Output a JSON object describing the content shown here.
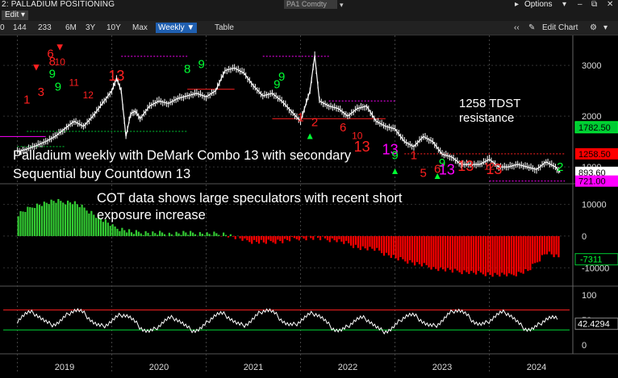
{
  "window": {
    "title": "2: PALLADIUM POSITIONING",
    "ticker": "PA1 Comdty",
    "options_label": "Options",
    "edit_label": "Edit"
  },
  "toolbar": {
    "items": [
      "144",
      "233",
      "6M",
      "3Y",
      "10Y",
      "Max"
    ],
    "selected_period": "Weekly",
    "table_label": "Table",
    "edit_chart_label": "Edit Chart"
  },
  "colors": {
    "price": "#ffffff",
    "buy_count": "#00ff33",
    "sell_count": "#ff2020",
    "countdown": "#ff00ff",
    "cot_positive": "#33cc33",
    "cot_negative": "#ff0000",
    "resistance": "#ff2020",
    "last_price_label": "#ffffff"
  },
  "annotations": {
    "resistance_title": "1258 TDST",
    "resistance_sub": "resistance",
    "price_note_line1": "Palladium weekly with DeMark Combo 13 with secondary",
    "price_note_line2": "Sequential buy Countdown 13",
    "cot_note_line1": "COT data shows large speculators with recent short",
    "cot_note_line2": "exposure increase"
  },
  "chart_data": [
    {
      "type": "line",
      "name": "price_panel",
      "x_ticks": [
        "2019",
        "2020",
        "2021",
        "2022",
        "2023",
        "2024"
      ],
      "y_ticks": [
        "3000",
        "2000",
        "1000"
      ],
      "ylim": [
        700,
        3400
      ],
      "series": [
        {
          "name": "Palladium weekly close",
          "x": [
            2019.0,
            2019.1,
            2019.2,
            2019.3,
            2019.4,
            2019.5,
            2019.6,
            2019.7,
            2019.8,
            2019.9,
            2020.0,
            2020.05,
            2020.1,
            2020.15,
            2020.2,
            2020.25,
            2020.3,
            2020.4,
            2020.5,
            2020.6,
            2020.7,
            2020.8,
            2020.9,
            2021.0,
            2021.1,
            2021.2,
            2021.3,
            2021.4,
            2021.5,
            2021.6,
            2021.7,
            2021.8,
            2021.9,
            2022.0,
            2022.1,
            2022.15,
            2022.2,
            2022.3,
            2022.4,
            2022.5,
            2022.6,
            2022.7,
            2022.8,
            2022.9,
            2023.0,
            2023.1,
            2023.2,
            2023.3,
            2023.4,
            2023.5,
            2023.6,
            2023.7,
            2023.8,
            2023.9,
            2024.0,
            2024.1,
            2024.2,
            2024.3,
            2024.4,
            2024.5,
            2024.6,
            2024.7,
            2024.75
          ],
          "values": [
            1300,
            1350,
            1420,
            1500,
            1600,
            1750,
            1900,
            1800,
            2000,
            2250,
            2500,
            2750,
            2500,
            1600,
            2050,
            2100,
            1950,
            2200,
            2300,
            2250,
            2350,
            2400,
            2450,
            2380,
            2500,
            2900,
            2950,
            2850,
            2600,
            2400,
            2450,
            2300,
            2100,
            1900,
            2500,
            3200,
            2300,
            2200,
            2150,
            2000,
            2150,
            2200,
            1900,
            1800,
            1750,
            1500,
            1400,
            1600,
            1500,
            1250,
            1200,
            1050,
            1050,
            1050,
            1150,
            1000,
            1000,
            1050,
            1000,
            950,
            1100,
            1000,
            893.6
          ]
        }
      ],
      "horizontal_levels": [
        {
          "label": "1782.50",
          "value": 1782.5,
          "color": "#00cc33"
        },
        {
          "label": "1258.50",
          "value": 1258.5,
          "color": "#ff0000"
        },
        {
          "label": "893.60",
          "value": 893.6,
          "color": "#ffffff"
        },
        {
          "label": "721.00",
          "value": 721.0,
          "color": "#ff00ff"
        }
      ],
      "markers": [
        {
          "text": "6",
          "color": "#ff2020"
        },
        {
          "text": "8",
          "color": "#ff2020"
        },
        {
          "text": "9",
          "color": "#00ff33"
        },
        {
          "text": "9",
          "color": "#00ff33"
        },
        {
          "text": "1",
          "color": "#ff2020"
        },
        {
          "text": "3",
          "color": "#ff2020"
        },
        {
          "text": "10",
          "color": "#ff2020"
        },
        {
          "text": "11",
          "color": "#ff2020"
        },
        {
          "text": "12",
          "color": "#ff2020"
        },
        {
          "text": "13",
          "color": "#ff2020"
        },
        {
          "text": "8",
          "color": "#00ff33"
        },
        {
          "text": "9",
          "color": "#00ff33"
        },
        {
          "text": "9",
          "color": "#00ff33"
        },
        {
          "text": "9",
          "color": "#00ff33"
        },
        {
          "text": "1",
          "color": "#ff2020"
        },
        {
          "text": "2",
          "color": "#ff2020"
        },
        {
          "text": "6",
          "color": "#ff2020"
        },
        {
          "text": "10",
          "color": "#ff2020"
        },
        {
          "text": "13",
          "color": "#ff2020"
        },
        {
          "text": "13",
          "color": "#ff00ff"
        },
        {
          "text": "9",
          "color": "#00ff33"
        },
        {
          "text": "1",
          "color": "#ff2020"
        },
        {
          "text": "5",
          "color": "#ff2020"
        },
        {
          "text": "6",
          "color": "#ff2020"
        },
        {
          "text": "9",
          "color": "#00ff33"
        },
        {
          "text": "13",
          "color": "#ff00ff"
        },
        {
          "text": "13",
          "color": "#ff2020"
        },
        {
          "text": "12",
          "color": "#ff2020"
        },
        {
          "text": "13",
          "color": "#ff2020"
        },
        {
          "text": "2",
          "color": "#00ff33"
        }
      ]
    },
    {
      "type": "bar",
      "name": "cot_panel",
      "y_ticks": [
        "10000",
        "0",
        "-10000"
      ],
      "ylim": [
        -14000,
        16000
      ],
      "last_value_label": "-7311",
      "last_value": -7311,
      "series": [
        {
          "name": "Large speculators net positioning",
          "x": [
            2019.0,
            2019.2,
            2019.4,
            2019.6,
            2019.8,
            2020.0,
            2020.2,
            2020.4,
            2020.6,
            2020.8,
            2021.0,
            2021.2,
            2021.4,
            2021.6,
            2021.8,
            2022.0,
            2022.2,
            2022.4,
            2022.6,
            2022.8,
            2023.0,
            2023.2,
            2023.4,
            2023.6,
            2023.8,
            2024.0,
            2024.2,
            2024.4,
            2024.6,
            2024.75
          ],
          "values": [
            7000,
            10000,
            11000,
            10500,
            7000,
            3000,
            1200,
            1000,
            800,
            900,
            700,
            600,
            -1500,
            -2000,
            -1500,
            -500,
            -800,
            -1500,
            -3500,
            -4500,
            -7000,
            -8500,
            -10000,
            -11000,
            -11500,
            -12000,
            -12500,
            -11000,
            -5000,
            -7311
          ]
        }
      ]
    },
    {
      "type": "line",
      "name": "oscillator_panel",
      "y_ticks": [
        "100",
        "50",
        "0"
      ],
      "ylim": [
        0,
        100
      ],
      "last_value_label": "42.4294",
      "last_value": 42.4294,
      "levels": [
        70,
        30
      ]
    }
  ]
}
